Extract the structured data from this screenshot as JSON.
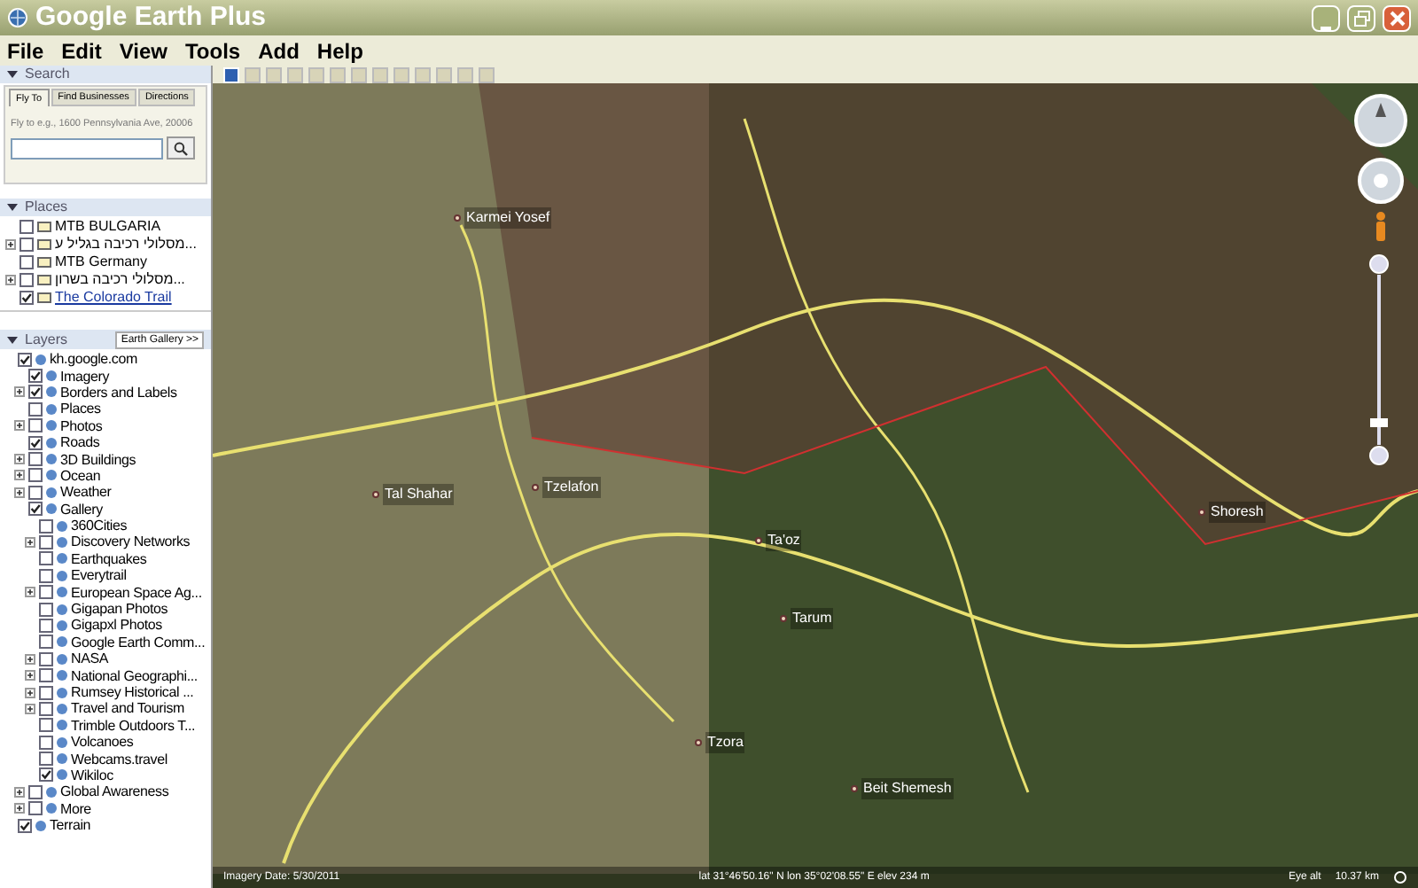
{
  "window": {
    "title": "Google Earth Plus"
  },
  "menu": [
    "File",
    "Edit",
    "View",
    "Tools",
    "Add",
    "Help"
  ],
  "toolbar": {
    "buttons": [
      {
        "selected": true
      },
      {
        "selected": false
      },
      {
        "selected": false
      },
      {
        "selected": false
      },
      {
        "selected": false
      },
      {
        "selected": false
      },
      {
        "selected": false
      },
      {
        "selected": false
      },
      {
        "selected": false
      },
      {
        "selected": false
      },
      {
        "selected": false
      },
      {
        "selected": false
      },
      {
        "selected": false
      }
    ]
  },
  "search": {
    "title": "Search",
    "tabs": [
      {
        "label": "Fly To",
        "selected": true
      },
      {
        "label": "Find Businesses",
        "selected": false
      },
      {
        "label": "Directions",
        "selected": false
      }
    ],
    "hint": "Fly to e.g., 1600 Pennsylvania Ave, 20006"
  },
  "places": {
    "title": "Places",
    "items": [
      {
        "label": "MTB BULGARIA",
        "checked": false,
        "collapsed": false,
        "link": false
      },
      {
        "label": "מסלולי רכיבה בגליל ע...",
        "checked": false,
        "collapsed": true,
        "link": false
      },
      {
        "label": "MTB Germany",
        "checked": false,
        "collapsed": false,
        "link": false
      },
      {
        "label": "מסלולי רכיבה בשרון...",
        "checked": false,
        "collapsed": true,
        "link": false
      },
      {
        "label": "The Colorado Trail",
        "checked": true,
        "collapsed": false,
        "link": true
      }
    ]
  },
  "layers": {
    "title": "Layers",
    "gallery_button": "Earth Gallery >>",
    "tree": [
      {
        "label": "kh.google.com",
        "checked": true,
        "children": [
          {
            "label": "Imagery",
            "checked": true
          },
          {
            "label": "Borders and Labels",
            "checked": true,
            "collapsed": true
          },
          {
            "label": "Places",
            "checked": false
          },
          {
            "label": "Photos",
            "checked": false,
            "collapsed": true
          },
          {
            "label": "Roads",
            "checked": true
          },
          {
            "label": "3D Buildings",
            "checked": false,
            "collapsed": true
          },
          {
            "label": "Ocean",
            "checked": false,
            "collapsed": true
          },
          {
            "label": "Weather",
            "checked": false,
            "collapsed": true
          },
          {
            "label": "Gallery",
            "checked": true,
            "children": [
              {
                "label": "360Cities",
                "checked": false
              },
              {
                "label": "Discovery Networks",
                "checked": false,
                "collapsed": true
              },
              {
                "label": "Earthquakes",
                "checked": false
              },
              {
                "label": "Everytrail",
                "checked": false
              },
              {
                "label": "European Space Ag...",
                "checked": false,
                "collapsed": true
              },
              {
                "label": "Gigapan Photos",
                "checked": false
              },
              {
                "label": "Gigapxl Photos",
                "checked": false
              },
              {
                "label": "Google Earth Comm...",
                "checked": false
              },
              {
                "label": "NASA",
                "checked": false,
                "collapsed": true
              },
              {
                "label": "National Geographi...",
                "checked": false,
                "collapsed": true
              },
              {
                "label": "Rumsey Historical ...",
                "checked": false,
                "collapsed": true
              },
              {
                "label": "Travel and Tourism",
                "checked": false,
                "collapsed": true
              },
              {
                "label": "Trimble Outdoors T...",
                "checked": false
              },
              {
                "label": "Volcanoes",
                "checked": false
              },
              {
                "label": "Webcams.travel",
                "checked": false
              },
              {
                "label": "Wikiloc",
                "checked": true
              }
            ]
          },
          {
            "label": "Global Awareness",
            "checked": false,
            "collapsed": true
          },
          {
            "label": "More",
            "checked": false,
            "collapsed": true
          }
        ]
      },
      {
        "label": "Terrain",
        "checked": true
      }
    ]
  },
  "map": {
    "zoom": {
      "level": 0.1
    },
    "places": [
      {
        "label": "Karmei Yosef"
      },
      {
        "label": "Tal Shahar"
      },
      {
        "label": "Tzelafon"
      },
      {
        "label": "Ta'oz"
      },
      {
        "label": "Tarum"
      },
      {
        "label": "Shoresh"
      },
      {
        "label": "Tzora"
      },
      {
        "label": "Beit Shemesh"
      }
    ]
  },
  "status_bar": {
    "imagery_date": "Imagery Date: 5/30/2011",
    "coordinates": "lat 31°46'50.16\" N  lon 35°02'08.55\" E  elev 234 m",
    "eye_alt_label": "Eye alt",
    "eye_alt": "10.37 km"
  }
}
